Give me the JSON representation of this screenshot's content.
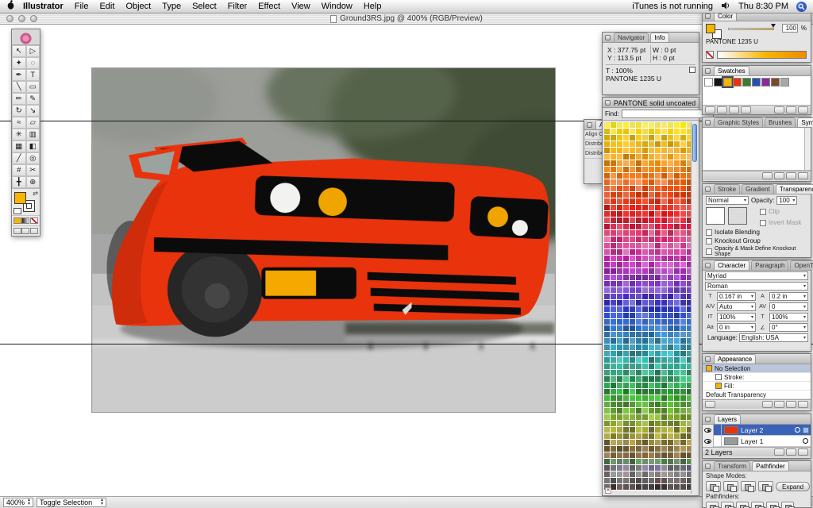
{
  "menu_bar": {
    "items": [
      "Illustrator",
      "File",
      "Edit",
      "Object",
      "Type",
      "Select",
      "Filter",
      "Effect",
      "View",
      "Window",
      "Help"
    ],
    "itunes_status": "iTunes is not running",
    "clock": "Thu 8:30 PM"
  },
  "window": {
    "title": "Ground3RS.jpg @ 400% (RGB/Preview)"
  },
  "status_bar": {
    "zoom": "400%",
    "mode": "Toggle Selection"
  },
  "toolbox": {
    "fill_color": "#f7b500",
    "tools": [
      {
        "name": "selection-tool",
        "glyph": "↖"
      },
      {
        "name": "direct-selection-tool",
        "glyph": "▷"
      },
      {
        "name": "magic-wand-tool",
        "glyph": "✦"
      },
      {
        "name": "lasso-tool",
        "glyph": "◌"
      },
      {
        "name": "pen-tool",
        "glyph": "✒"
      },
      {
        "name": "type-tool",
        "glyph": "T"
      },
      {
        "name": "line-segment-tool",
        "glyph": "╲"
      },
      {
        "name": "rectangle-tool",
        "glyph": "▭"
      },
      {
        "name": "paintbrush-tool",
        "glyph": "✏"
      },
      {
        "name": "pencil-tool",
        "glyph": "✎"
      },
      {
        "name": "rotate-tool",
        "glyph": "↻"
      },
      {
        "name": "scale-tool",
        "glyph": "↘"
      },
      {
        "name": "warp-tool",
        "glyph": "≈"
      },
      {
        "name": "free-transform-tool",
        "glyph": "▱"
      },
      {
        "name": "symbol-sprayer-tool",
        "glyph": "✳"
      },
      {
        "name": "graph-tool",
        "glyph": "▥"
      },
      {
        "name": "mesh-tool",
        "glyph": "▦"
      },
      {
        "name": "gradient-tool",
        "glyph": "◧"
      },
      {
        "name": "eyedropper-tool",
        "glyph": "╱"
      },
      {
        "name": "blend-tool",
        "glyph": "◎"
      },
      {
        "name": "slice-tool",
        "glyph": "#"
      },
      {
        "name": "scissors-tool",
        "glyph": "✂"
      },
      {
        "name": "hand-tool",
        "glyph": "╋"
      },
      {
        "name": "zoom-tool",
        "glyph": "⊕"
      }
    ]
  },
  "navigator_info": {
    "tabs": [
      "Navigator",
      "Info"
    ],
    "x_label": "X :",
    "x_value": "377.75 pt",
    "y_label": "Y :",
    "y_value": "113.5 pt",
    "w_label": "W :",
    "w_value": "0 pt",
    "h_label": "H :",
    "h_value": "0 pt",
    "t_label": "T :",
    "t_value": "100%",
    "swatch_name": "PANTONE 1235 U"
  },
  "pantone": {
    "title": "PANTONE solid uncoated",
    "find_label": "Find:",
    "cols": 14,
    "rows": 58,
    "hue_stops": [
      [
        55,
        88,
        58
      ],
      [
        48,
        90,
        54
      ],
      [
        40,
        92,
        52
      ],
      [
        32,
        92,
        52
      ],
      [
        22,
        88,
        54
      ],
      [
        12,
        84,
        52
      ],
      [
        2,
        78,
        50
      ],
      [
        -12,
        72,
        52
      ],
      [
        -28,
        65,
        58
      ],
      [
        -45,
        60,
        52
      ],
      [
        -65,
        55,
        48
      ],
      [
        -90,
        55,
        50
      ],
      [
        -112,
        58,
        52
      ],
      [
        -130,
        62,
        50
      ],
      [
        -147,
        60,
        48
      ],
      [
        -162,
        55,
        46
      ],
      [
        -178,
        50,
        44
      ],
      [
        -200,
        48,
        42
      ],
      [
        -222,
        50,
        42
      ],
      [
        -250,
        50,
        44
      ],
      [
        -275,
        52,
        45
      ],
      [
        -296,
        48,
        42
      ],
      [
        -312,
        38,
        40
      ],
      [
        -326,
        28,
        38
      ],
      [
        0,
        0,
        52
      ],
      [
        0,
        0,
        30
      ]
    ]
  },
  "align_panel": {
    "tab": "Align",
    "labels": [
      "Align Objects:",
      "Distribute Objects:",
      "Distribute Spacing:"
    ]
  },
  "color_panel": {
    "tab": "Color",
    "swatch_name": "PANTONE 1235 U",
    "value": "100",
    "unit": "%",
    "fill_color": "#f7b500"
  },
  "swatches_panel": {
    "tab": "Swatches",
    "swatches": [
      {
        "name": "white",
        "color": "#ffffff",
        "selected": false
      },
      {
        "name": "black",
        "color": "#141414",
        "selected": false
      },
      {
        "name": "pantone-1235",
        "color": "#f7b500",
        "selected": true
      },
      {
        "name": "red",
        "color": "#e8330c",
        "selected": false
      },
      {
        "name": "green",
        "color": "#3a7d2c",
        "selected": false
      },
      {
        "name": "blue",
        "color": "#2a4fb0",
        "selected": false
      },
      {
        "name": "purple",
        "color": "#8a2a9a",
        "selected": false
      },
      {
        "name": "brown",
        "color": "#7a4a2a",
        "selected": false
      },
      {
        "name": "gray",
        "color": "#a8a8a8",
        "selected": false
      }
    ]
  },
  "styles_panel": {
    "tabs": [
      "Graphic Styles",
      "Brushes",
      "Symbols"
    ]
  },
  "transparency_panel": {
    "tabs": [
      "Stroke",
      "Gradient",
      "Transparency"
    ],
    "blend_mode": "Normal",
    "opacity_label": "Opacity:",
    "opacity_value": "100",
    "clip_label": "Clip",
    "invert_label": "Invert Mask",
    "isolate_label": "Isolate Blending",
    "knockout_label": "Knockout Group",
    "mask_label": "Opacity & Mask Define Knockout Shape"
  },
  "character_panel": {
    "tabs": [
      "Character",
      "Paragraph",
      "OpenType"
    ],
    "font": "Myriad",
    "style": "Roman",
    "size": "0.167 in",
    "leading": "0.2 in",
    "kerning": "Auto",
    "tracking": "0",
    "h_scale": "100%",
    "v_scale": "100%",
    "baseline": "0 in",
    "rotation": "0°",
    "language_label": "Language:",
    "language": "English: USA"
  },
  "appearance_panel": {
    "tab": "Appearance",
    "rows": [
      {
        "label": "No Selection",
        "chip": "#f7b500",
        "selected": true,
        "indent": false
      },
      {
        "label": "Stroke:",
        "chip": "",
        "selected": false,
        "indent": true
      },
      {
        "label": "Fill:",
        "chip": "#f7b500",
        "selected": false,
        "indent": true
      },
      {
        "label": "Default Transparency",
        "chip": null,
        "selected": false,
        "indent": false
      }
    ]
  },
  "layers_panel": {
    "tab": "Layers",
    "layers": [
      {
        "name": "Layer 2",
        "selected": true,
        "thumb": "#e8330c"
      },
      {
        "name": "Layer 1",
        "selected": false,
        "thumb": "#9a9a9a"
      }
    ],
    "status": "2 Layers"
  },
  "pathfinder_panel": {
    "tabs": [
      "Transform",
      "Pathfinder"
    ],
    "shape_modes_label": "Shape Modes:",
    "expand_label": "Expand",
    "pathfinders_label": "Pathfinders:",
    "shape_modes": [
      "add-to-shape-area",
      "subtract-from-shape-area",
      "intersect-shape-areas",
      "exclude-shape-areas"
    ],
    "pathfinders": [
      "divide",
      "trim",
      "merge",
      "crop",
      "outline",
      "minus-back"
    ]
  },
  "icons": {
    "none_swatch": "✕",
    "font_size": "T",
    "leading": "A",
    "kerning": "A/V",
    "tracking": "AV",
    "h_scale": "IT",
    "v_scale": "T",
    "baseline": "Aa",
    "rotation": "∠",
    "swap": "⇄"
  },
  "artwork": {
    "body_red": "#e8330c",
    "shade_red": "#c92b0c",
    "light_yellow": "#f0a400",
    "fog_yellow": "#f5a800",
    "light_white": "#f2f2f0",
    "photo_gray": "#a6a6a6",
    "tree_green": "#46523a",
    "road_gray": "#c3c3c3",
    "black": "#0b0b0b"
  }
}
